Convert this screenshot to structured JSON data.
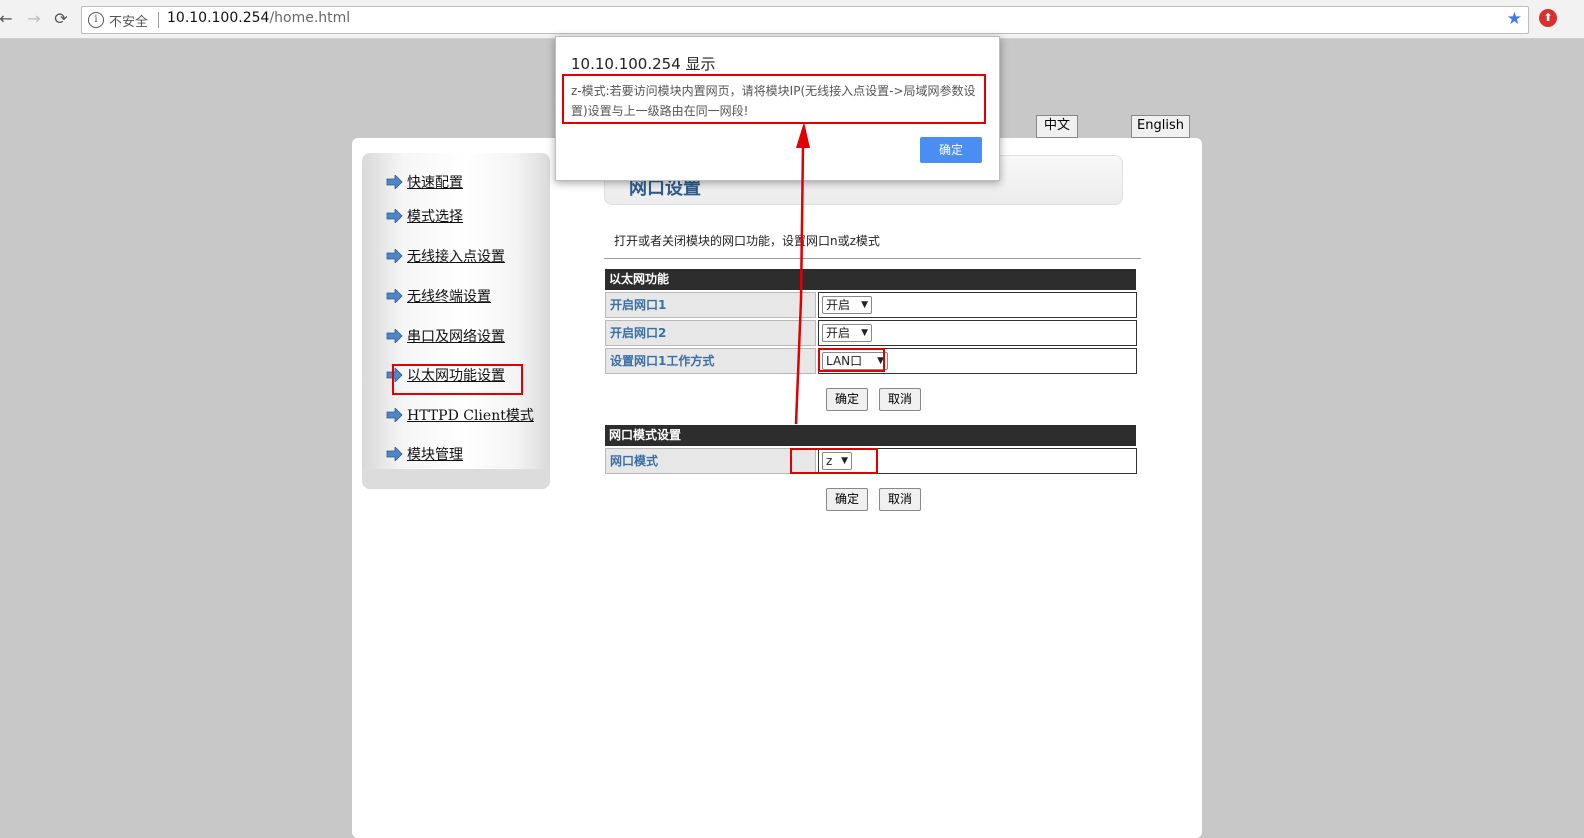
{
  "browser": {
    "security_label": "不安全",
    "url_host": "10.10.100.254",
    "url_path": "/home.html",
    "back_glyph": "←",
    "forward_glyph": "→",
    "reload_glyph": "⟳",
    "info_glyph": "i",
    "star_glyph": "★",
    "extension_glyph": "⬆"
  },
  "language": {
    "chinese": "中文",
    "english": "English"
  },
  "sidebar": {
    "items": [
      {
        "label": "快速配置"
      },
      {
        "label": "模式选择"
      },
      {
        "label": "无线接入点设置"
      },
      {
        "label": "无线终端设置"
      },
      {
        "label": "串口及网络设置"
      },
      {
        "label": "以太网功能设置"
      },
      {
        "label": "HTTPD Client模式"
      },
      {
        "label": "模块管理"
      }
    ]
  },
  "page": {
    "title": "网口设置",
    "description": "打开或者关闭模块的网口功能，设置网口n或z模式"
  },
  "ethernet": {
    "heading": "以太网功能",
    "rows": [
      {
        "label": "开启网口1",
        "value": "开启"
      },
      {
        "label": "开启网口2",
        "value": "开启"
      },
      {
        "label": "设置网口1工作方式",
        "value": "LAN口"
      }
    ],
    "ok_label": "确定",
    "cancel_label": "取消"
  },
  "port_mode": {
    "heading": "网口模式设置",
    "rows": [
      {
        "label": "网口模式",
        "value": "z"
      }
    ],
    "ok_label": "确定",
    "cancel_label": "取消"
  },
  "dialog": {
    "title": "10.10.100.254 显示",
    "message": "z-模式:若要访问模块内置网页，请将模块IP(无线接入点设置->局域网参数设置)设置与上一级路由在同一网段!",
    "ok_label": "确定"
  },
  "colors": {
    "annotation_red": "#e00000",
    "dialog_button": "#4a8ef2",
    "label_text": "#3b6fa4"
  }
}
